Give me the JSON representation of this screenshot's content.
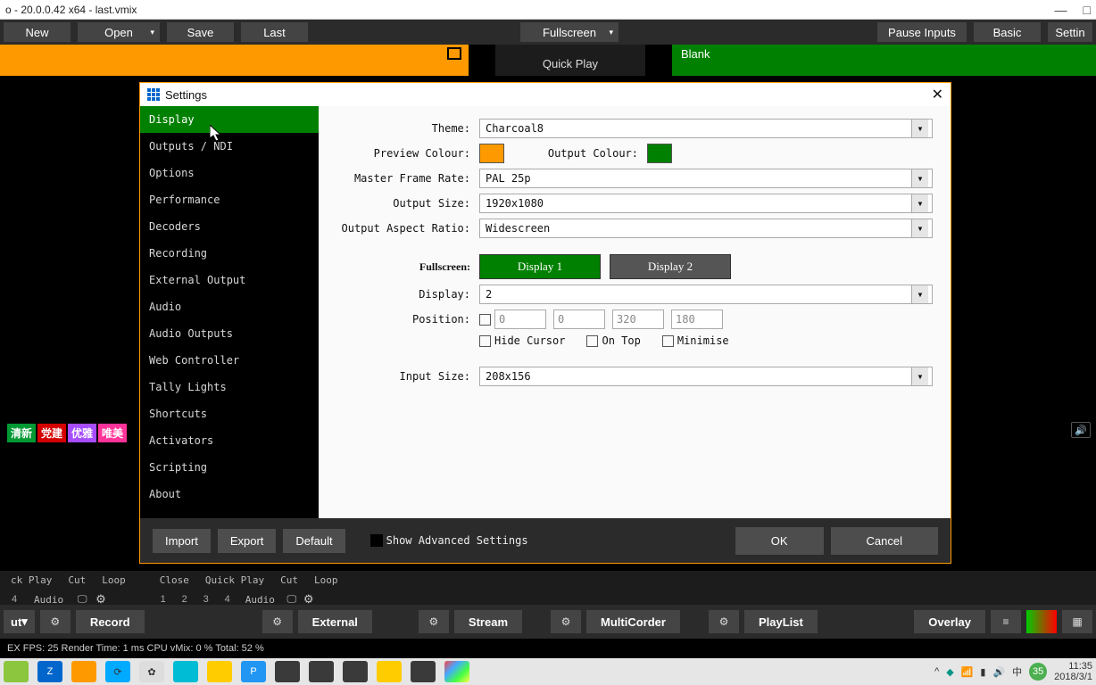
{
  "titlebar": {
    "text": "o - 20.0.0.42 x64 - last.vmix"
  },
  "toolbar": {
    "new": "New",
    "open": "Open",
    "save": "Save",
    "last": "Last",
    "fullscreen": "Fullscreen",
    "pause_inputs": "Pause Inputs",
    "basic": "Basic",
    "settings": "Settin"
  },
  "banner": {
    "quickplay": "Quick Play",
    "blank": "Blank"
  },
  "tags": {
    "t1": "清新",
    "t2": "党建",
    "t3": "优雅",
    "t4": "唯美"
  },
  "dialog": {
    "title": "Settings",
    "nav": [
      "Display",
      "Outputs / NDI",
      "Options",
      "Performance",
      "Decoders",
      "Recording",
      "External Output",
      "Audio",
      "Audio Outputs",
      "Web Controller",
      "Tally Lights",
      "Shortcuts",
      "Activators",
      "Scripting",
      "About"
    ],
    "labels": {
      "theme": "Theme:",
      "preview_colour": "Preview Colour:",
      "output_colour": "Output Colour:",
      "master_frame_rate": "Master Frame Rate:",
      "output_size": "Output Size:",
      "output_aspect_ratio": "Output Aspect Ratio:",
      "fullscreen": "Fullscreen:",
      "display": "Display:",
      "position": "Position:",
      "hide_cursor": "Hide Cursor",
      "on_top": "On Top",
      "minimise": "Minimise",
      "input_size": "Input Size:"
    },
    "values": {
      "theme": "Charcoal8",
      "master_frame_rate": "PAL 25p",
      "output_size": "1920x1080",
      "output_aspect_ratio": "Widescreen",
      "display_num": "2",
      "position": [
        "0",
        "0",
        "320",
        "180"
      ],
      "input_size": "208x156",
      "display_btn_1": "Display 1",
      "display_btn_2": "Display 2"
    },
    "colors": {
      "preview": "#ff9900",
      "output": "#008000"
    },
    "footer": {
      "import": "Import",
      "export": "Export",
      "default": "Default",
      "show_advanced": "Show Advanced Settings",
      "ok": "OK",
      "cancel": "Cancel"
    }
  },
  "playback": {
    "left_group": {
      "ck_play": "ck Play",
      "cut": "Cut",
      "loop": "Loop",
      "num": "4",
      "audio": "Audio"
    },
    "right_group": {
      "close": "Close",
      "quick_play": "Quick Play",
      "cut": "Cut",
      "loop": "Loop",
      "nums": [
        "1",
        "2",
        "3",
        "4"
      ],
      "audio": "Audio"
    }
  },
  "footer": {
    "ut": "ut",
    "record": "Record",
    "external": "External",
    "stream": "Stream",
    "multicorder": "MultiCorder",
    "playlist": "PlayList",
    "overlay": "Overlay"
  },
  "status": "EX  FPS:  25   Render Time:   1 ms   CPU vMix:   0 %   Total:   52 %",
  "tray": {
    "time": "11:35",
    "date": "2018/3/1",
    "badge": "35"
  }
}
